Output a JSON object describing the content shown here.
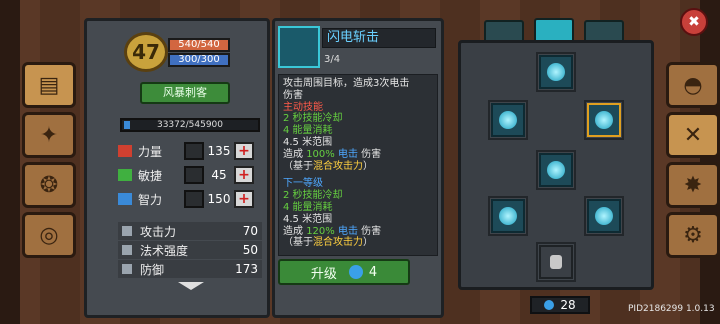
{
  "player": {
    "level": "47",
    "hp": "540/540",
    "mp": "300/300",
    "class_name": "风暴刺客",
    "xp": "33372/545900"
  },
  "stats": [
    {
      "label": "力量",
      "value": "135",
      "color": "#d04030"
    },
    {
      "label": "敏捷",
      "value": "45",
      "color": "#40b040"
    },
    {
      "label": "智力",
      "value": "150",
      "color": "#3a8ad8"
    }
  ],
  "attributes": [
    {
      "label": "攻击力",
      "value": "70"
    },
    {
      "label": "法术强度",
      "value": "50"
    },
    {
      "label": "防御",
      "value": "173"
    }
  ],
  "skill": {
    "name": "闪电斩击",
    "level": "3/4",
    "desc_line1": "攻击周围目标，造成3次电击",
    "desc_line2": "伤害",
    "active_label": "主动技能",
    "current": {
      "cooldown": "2 秒技能冷却",
      "energy": "4 能量消耗",
      "range": "4.5 米范围",
      "damage_prefix": "造成",
      "damage_pct": "100%",
      "damage_type": "电击",
      "damage_suffix": "伤害",
      "based_prefix": "（基于",
      "based_on": "混合攻击力",
      "based_suffix": "）"
    },
    "next_label": "下一等级",
    "next": {
      "cooldown": "2 秒技能冷却",
      "energy": "4 能量消耗",
      "range": "4.5 米范围",
      "damage_prefix": "造成",
      "damage_pct": "120%",
      "damage_type": "电击",
      "damage_suffix": "伤害",
      "based_prefix": "（基于",
      "based_on": "混合攻击力",
      "based_suffix": "）"
    },
    "upgrade_label": "升级",
    "upgrade_cost": "4"
  },
  "tree": {
    "gems": "28"
  },
  "footer": {
    "pid": "PID2186299 1.0.13"
  },
  "colors": {
    "accent_cyan": "#2ab0c0",
    "upgrade_green": "#3a8a38",
    "hp_orange": "#d26640",
    "mp_blue": "#4070c0"
  }
}
